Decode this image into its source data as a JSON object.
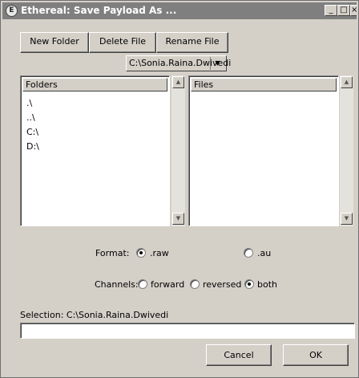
{
  "window": {
    "title": "Ethereal: Save Payload As ...",
    "app_icon": "ethereal-app-icon"
  },
  "title_buttons": {
    "minimize": "_",
    "maximize": "□",
    "close": "×"
  },
  "toolbar": {
    "new_folder": "New Folder",
    "delete_file": "Delete File",
    "rename_file": "Rename File"
  },
  "path_combo": {
    "value": "C:\\Sonia.Raina.Dwivedi",
    "arrow": "▼"
  },
  "folders": {
    "header": "Folders",
    "items": [
      ".\\",
      "..\\",
      "C:\\",
      "D:\\"
    ]
  },
  "files": {
    "header": "Files",
    "items": []
  },
  "scroll": {
    "up": "▲",
    "down": "▼"
  },
  "format": {
    "label": "Format:",
    "options": [
      ".raw",
      ".au"
    ],
    "selected": ".raw"
  },
  "channels": {
    "label": "Channels:",
    "options": [
      "forward",
      "reversed",
      "both"
    ],
    "selected": "both"
  },
  "selection": {
    "label": "Selection: C:\\Sonia.Raina.Dwivedi",
    "value": ""
  },
  "buttons": {
    "cancel": "Cancel",
    "ok": "OK"
  },
  "colors": {
    "titlebar": "#7f7f7f",
    "face": "#d4d0c8",
    "list_bg": "#ffffff"
  }
}
